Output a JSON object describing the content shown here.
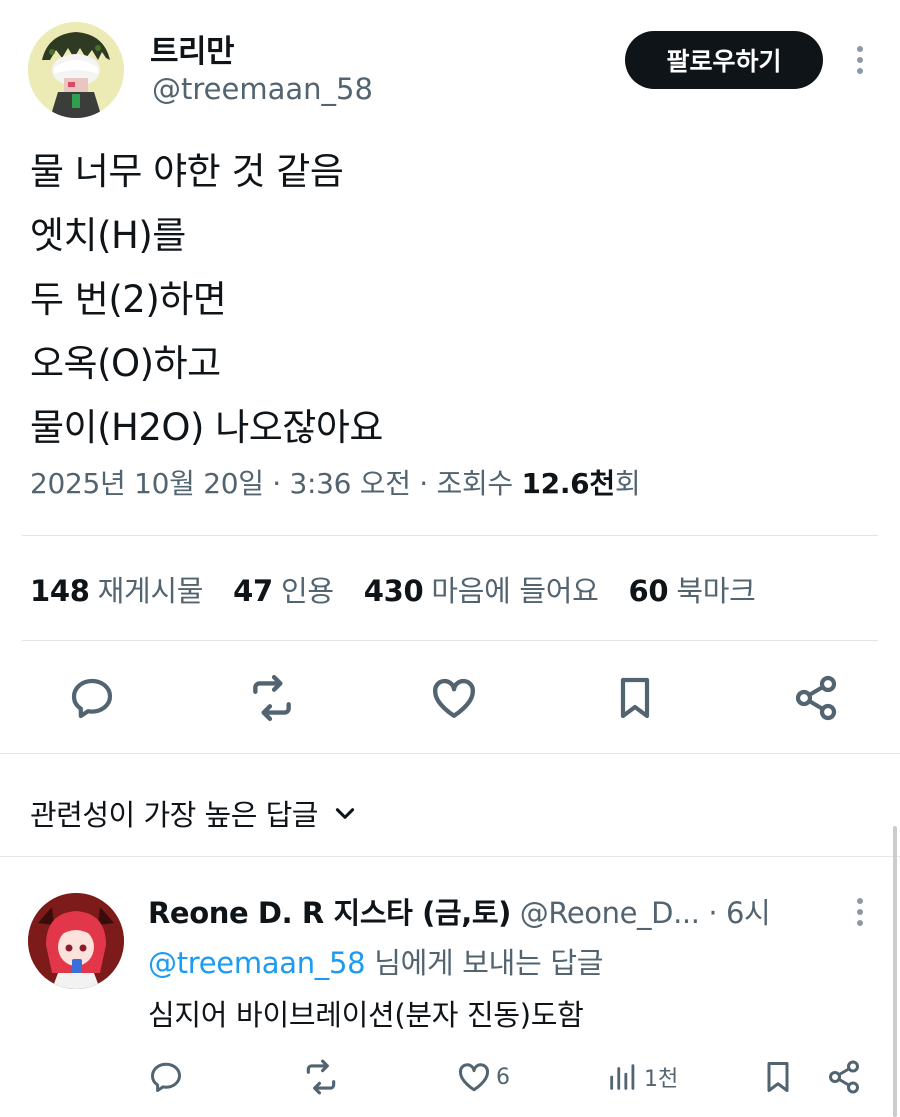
{
  "author": {
    "display_name": "트리만",
    "handle": "@treemaan_58",
    "avatar_icon": "avatar-cartoon-icon"
  },
  "follow_button_label": "팔로우하기",
  "post": {
    "lines": [
      "물 너무 야한 것 같음",
      "엣치(H)를",
      "두 번(2)하면",
      "오옥(O)하고",
      "물이(H2O) 나오잖아요"
    ],
    "meta_prefix": "2025년 10월 20일 · 3:36 오전 · 조회수 ",
    "views": "12.6천",
    "views_suffix": "회"
  },
  "stats": [
    {
      "num": "148",
      "label": "재게시물"
    },
    {
      "num": "47",
      "label": "인용"
    },
    {
      "num": "430",
      "label": "마음에 들어요"
    },
    {
      "num": "60",
      "label": "북마크"
    }
  ],
  "actions": [
    "reply-icon",
    "repost-icon",
    "like-icon",
    "bookmark-icon",
    "share-icon"
  ],
  "replies_header": "관련성이 가장 높은 답글",
  "reply": {
    "display_name": "Reone D. R 지스타 (금,토)",
    "handle": "@Reone_D...",
    "time": "· 6시",
    "to_mention": "@treemaan_58",
    "to_suffix": " 님에게 보내는 답글",
    "text": "심지어 바이브레이션(분자 진동)도함",
    "like_count": "6",
    "view_count": "1천"
  },
  "colors": {
    "text": "#0f1419",
    "muted": "#536471",
    "accent": "#1d9bf0",
    "button_bg": "#0f1419"
  }
}
